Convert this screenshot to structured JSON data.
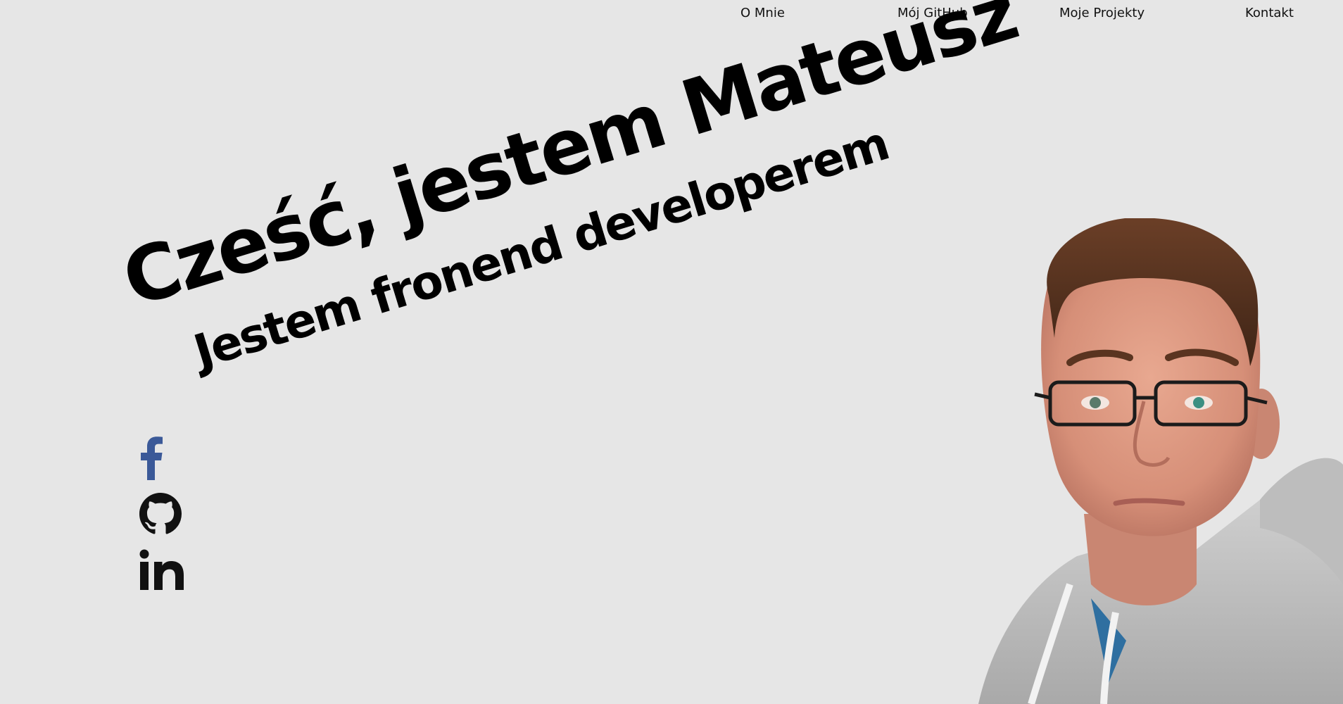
{
  "nav": {
    "items": [
      {
        "label": "O Mnie"
      },
      {
        "label": "Mój GitHub"
      },
      {
        "label": "Moje Projekty"
      },
      {
        "label": "Kontakt"
      }
    ]
  },
  "hero": {
    "title": "Cześć, jestem Mateusz",
    "subtitle": "Jestem fronend developerem"
  },
  "socials": [
    {
      "icon": "facebook-icon",
      "color": "#3b5998"
    },
    {
      "icon": "github-icon",
      "color": "#111111"
    },
    {
      "icon": "linkedin-icon",
      "color": "#111111"
    }
  ],
  "portrait": {
    "description_icon": "portrait-photo"
  },
  "colors": {
    "background": "#e6e6e6",
    "text": "#000000",
    "facebook": "#3b5998"
  }
}
